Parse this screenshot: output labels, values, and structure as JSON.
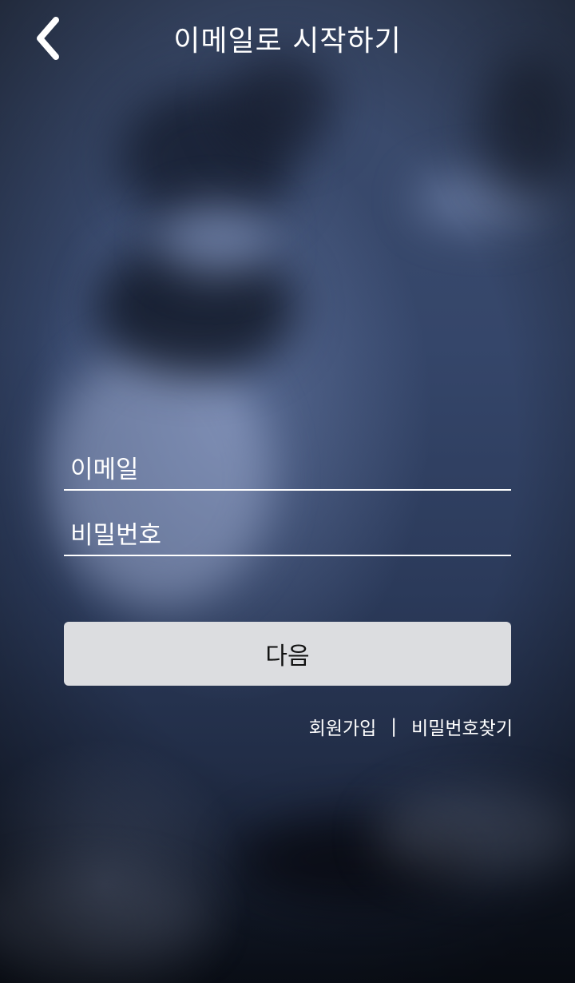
{
  "header": {
    "back_icon": "chevron-left-icon",
    "title": "이메일로 시작하기"
  },
  "form": {
    "email_placeholder": "이메일",
    "password_placeholder": "비밀번호",
    "next_label": "다음"
  },
  "links": {
    "signup": "회원가입",
    "separator": "|",
    "find_password": "비밀번호찾기"
  },
  "colors": {
    "background": "#2b3a55",
    "button": "#dcdde0",
    "text": "#ffffff"
  }
}
